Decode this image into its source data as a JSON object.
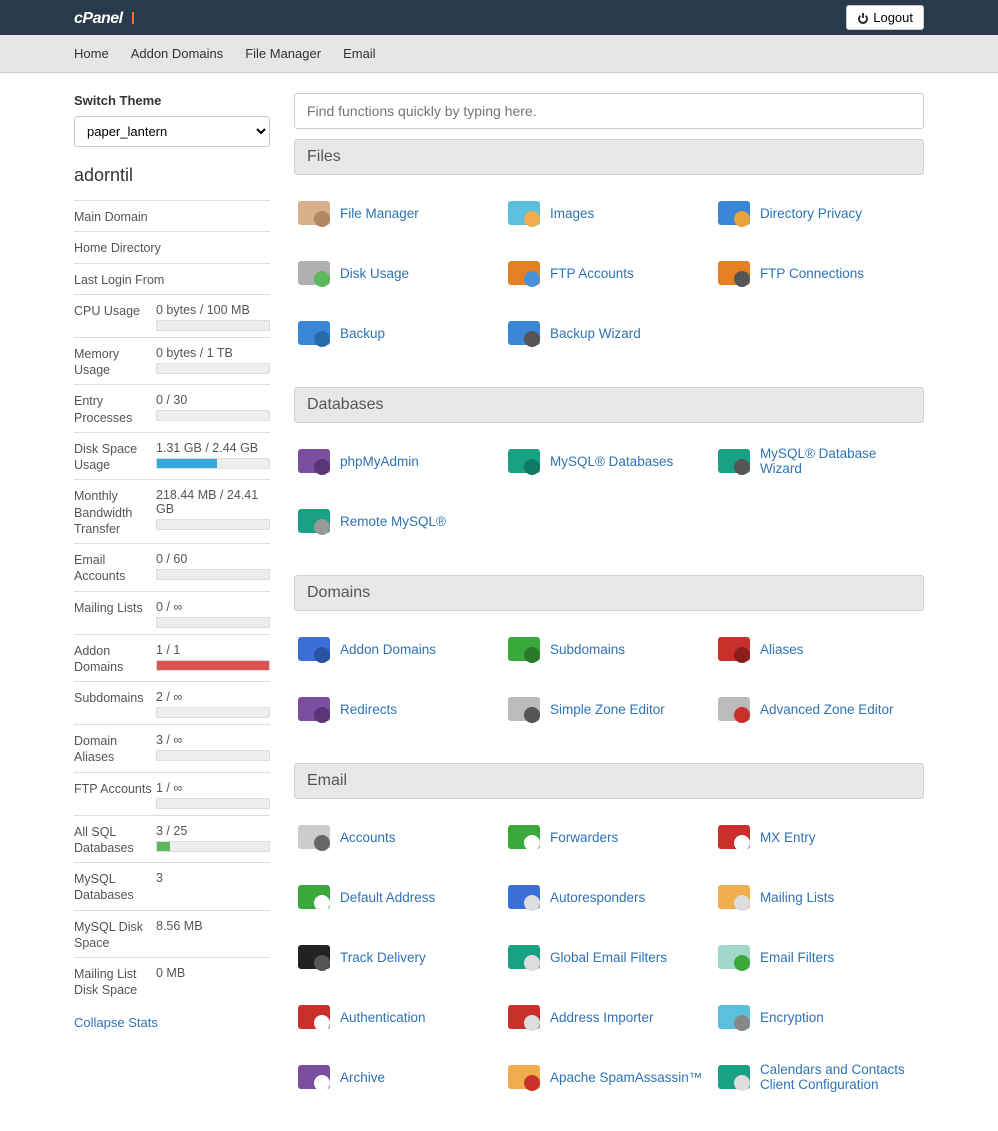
{
  "header": {
    "brand": "cPanel",
    "logout": "Logout"
  },
  "nav": [
    "Home",
    "Addon Domains",
    "File Manager",
    "Email"
  ],
  "sidebar": {
    "switch_theme_label": "Switch Theme",
    "theme_value": "paper_lantern",
    "account": "adorntil",
    "collapse": "Collapse Stats",
    "simple_rows": [
      {
        "label": "Main Domain"
      },
      {
        "label": "Home Directory"
      },
      {
        "label": "Last Login From"
      }
    ],
    "stats": [
      {
        "label": "CPU Usage",
        "value": "0 bytes / 100 MB",
        "bar": true,
        "pct": 0,
        "color": "#5bc0de"
      },
      {
        "label": "Memory Usage",
        "value": "0 bytes / 1 TB",
        "bar": true,
        "pct": 0,
        "color": "#5bc0de"
      },
      {
        "label": "Entry Processes",
        "value": "0 / 30",
        "bar": true,
        "pct": 0,
        "color": "#5bc0de"
      },
      {
        "label": "Disk Space Usage",
        "value": "1.31 GB / 2.44 GB",
        "bar": true,
        "pct": 54,
        "color": "#34aadc"
      },
      {
        "label": "Monthly Bandwidth Transfer",
        "value": "218.44 MB / 24.41 GB",
        "bar": true,
        "pct": 0,
        "color": "#5bc0de"
      },
      {
        "label": "Email Accounts",
        "value": "0 / 60",
        "bar": true,
        "pct": 0,
        "color": "#5bc0de"
      },
      {
        "label": "Mailing Lists",
        "value": "0 / ∞",
        "bar": true,
        "pct": 0,
        "color": "#5bc0de"
      },
      {
        "label": "Addon Domains",
        "value": "1 / 1",
        "bar": true,
        "pct": 100,
        "color": "#d9534f"
      },
      {
        "label": "Subdomains",
        "value": "2 / ∞",
        "bar": true,
        "pct": 0,
        "color": "#5bc0de"
      },
      {
        "label": "Domain Aliases",
        "value": "3 / ∞",
        "bar": true,
        "pct": 0,
        "color": "#5bc0de"
      },
      {
        "label": "FTP Accounts",
        "value": "1 / ∞",
        "bar": true,
        "pct": 0,
        "color": "#5bc0de"
      },
      {
        "label": "All SQL Databases",
        "value": "3 / 25",
        "bar": true,
        "pct": 12,
        "color": "#5cb85c"
      },
      {
        "label": "MySQL Databases",
        "value": "3",
        "bar": false
      },
      {
        "label": "MySQL Disk Space",
        "value": "8.56 MB",
        "bar": false
      },
      {
        "label": "Mailing List Disk Space",
        "value": "0 MB",
        "bar": false
      }
    ]
  },
  "search": {
    "placeholder": "Find functions quickly by typing here."
  },
  "sections": [
    {
      "title": "Files",
      "items": [
        {
          "label": "File Manager",
          "icon": "folder-icon",
          "c1": "#d8b08c",
          "c2": "#b0875f"
        },
        {
          "label": "Images",
          "icon": "images-icon",
          "c1": "#5bc0de",
          "c2": "#f0ad4e"
        },
        {
          "label": "Directory Privacy",
          "icon": "dir-privacy-icon",
          "c1": "#3a87d8",
          "c2": "#e8a33d"
        },
        {
          "label": "Disk Usage",
          "icon": "disk-usage-icon",
          "c1": "#b0b0b0",
          "c2": "#5cb85c"
        },
        {
          "label": "FTP Accounts",
          "icon": "ftp-accounts-icon",
          "c1": "#e67e22",
          "c2": "#4a90d9"
        },
        {
          "label": "FTP Connections",
          "icon": "ftp-connections-icon",
          "c1": "#e67e22",
          "c2": "#555"
        },
        {
          "label": "Backup",
          "icon": "backup-icon",
          "c1": "#3a87d8",
          "c2": "#2a6aa8"
        },
        {
          "label": "Backup Wizard",
          "icon": "backup-wizard-icon",
          "c1": "#3a87d8",
          "c2": "#555"
        }
      ]
    },
    {
      "title": "Databases",
      "items": [
        {
          "label": "phpMyAdmin",
          "icon": "phpmyadmin-icon",
          "c1": "#7b4fa0",
          "c2": "#5a3577"
        },
        {
          "label": "MySQL® Databases",
          "icon": "mysql-db-icon",
          "c1": "#1aa085",
          "c2": "#0e7a63"
        },
        {
          "label": "MySQL® Database Wizard",
          "icon": "mysql-wizard-icon",
          "c1": "#1aa085",
          "c2": "#555"
        },
        {
          "label": "Remote MySQL®",
          "icon": "remote-mysql-icon",
          "c1": "#1aa085",
          "c2": "#999"
        }
      ]
    },
    {
      "title": "Domains",
      "items": [
        {
          "label": "Addon Domains",
          "icon": "addon-domains-icon",
          "c1": "#3a6fd8",
          "c2": "#2a52a0"
        },
        {
          "label": "Subdomains",
          "icon": "subdomains-icon",
          "c1": "#3ba83b",
          "c2": "#2a7a2a"
        },
        {
          "label": "Aliases",
          "icon": "aliases-icon",
          "c1": "#c9302c",
          "c2": "#8a1e1b"
        },
        {
          "label": "Redirects",
          "icon": "redirects-icon",
          "c1": "#7b4fa0",
          "c2": "#5a3577"
        },
        {
          "label": "Simple Zone Editor",
          "icon": "simple-zone-icon",
          "c1": "#bbb",
          "c2": "#555"
        },
        {
          "label": "Advanced Zone Editor",
          "icon": "advanced-zone-icon",
          "c1": "#bbb",
          "c2": "#c9302c"
        }
      ]
    },
    {
      "title": "Email",
      "items": [
        {
          "label": "Accounts",
          "icon": "email-accounts-icon",
          "c1": "#ccc",
          "c2": "#666"
        },
        {
          "label": "Forwarders",
          "icon": "forwarders-icon",
          "c1": "#3ba83b",
          "c2": "#fff"
        },
        {
          "label": "MX Entry",
          "icon": "mx-entry-icon",
          "c1": "#c9302c",
          "c2": "#fff"
        },
        {
          "label": "Default Address",
          "icon": "default-address-icon",
          "c1": "#3ba83b",
          "c2": "#fff"
        },
        {
          "label": "Autoresponders",
          "icon": "autoresponders-icon",
          "c1": "#3a6fd8",
          "c2": "#ddd"
        },
        {
          "label": "Mailing Lists",
          "icon": "mailing-lists-icon",
          "c1": "#f0ad4e",
          "c2": "#ddd"
        },
        {
          "label": "Track Delivery",
          "icon": "track-delivery-icon",
          "c1": "#222",
          "c2": "#555"
        },
        {
          "label": "Global Email Filters",
          "icon": "global-filters-icon",
          "c1": "#1aa085",
          "c2": "#ddd"
        },
        {
          "label": "Email Filters",
          "icon": "email-filters-icon",
          "c1": "#9fd8c8",
          "c2": "#3ba83b"
        },
        {
          "label": "Authentication",
          "icon": "authentication-icon",
          "c1": "#c9302c",
          "c2": "#fff"
        },
        {
          "label": "Address Importer",
          "icon": "address-importer-icon",
          "c1": "#c9302c",
          "c2": "#ddd"
        },
        {
          "label": "Encryption",
          "icon": "encryption-icon",
          "c1": "#5bc0de",
          "c2": "#888"
        },
        {
          "label": "Archive",
          "icon": "archive-icon",
          "c1": "#7b4fa0",
          "c2": "#fff"
        },
        {
          "label": "Apache SpamAssassin™",
          "icon": "spamassassin-icon",
          "c1": "#f0ad4e",
          "c2": "#c9302c"
        },
        {
          "label": "Calendars and Contacts Client Configuration",
          "icon": "calendars-icon",
          "c1": "#1aa085",
          "c2": "#ddd"
        }
      ]
    }
  ]
}
